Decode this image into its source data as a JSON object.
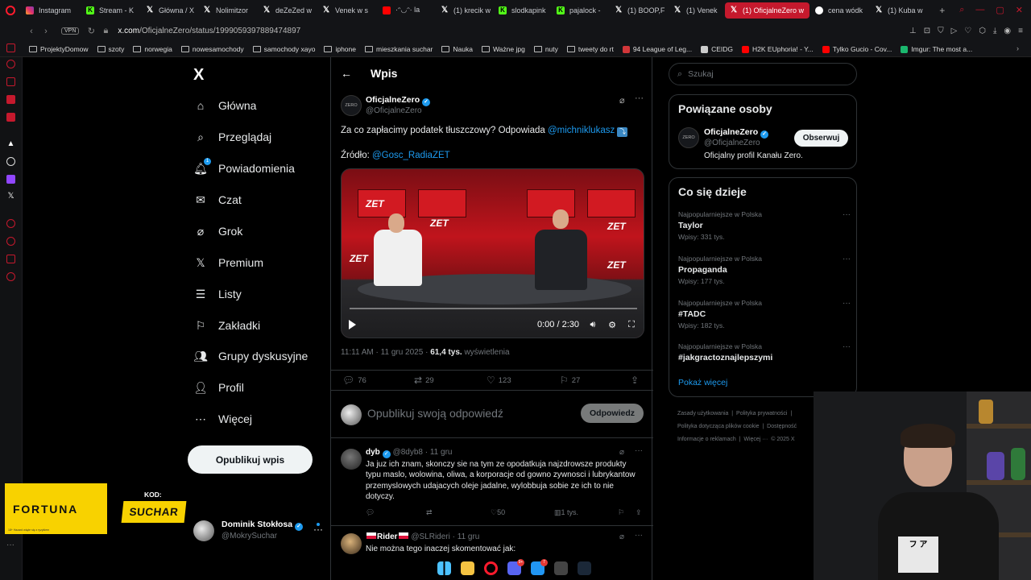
{
  "browser": {
    "tabs": [
      {
        "label": "Instagram",
        "icon": "instagram-icon",
        "active": false
      },
      {
        "label": "Stream - K",
        "icon": "kick-icon",
        "active": false
      },
      {
        "label": "Główna / X",
        "icon": "x-icon",
        "active": false
      },
      {
        "label": "Nolimitzor",
        "icon": "x-icon",
        "active": false
      },
      {
        "label": "deZeZed w",
        "icon": "x-icon",
        "active": false
      },
      {
        "label": "Venek w s",
        "icon": "x-icon",
        "active": false
      },
      {
        "label": "·ᵔ◡ᵔ· la",
        "icon": "youtube-icon",
        "active": false
      },
      {
        "label": "(1) krecik w",
        "icon": "x-icon",
        "active": false
      },
      {
        "label": "slodkapink",
        "icon": "kick-icon",
        "active": false
      },
      {
        "label": "pajalock -",
        "icon": "kick-icon",
        "active": false
      },
      {
        "label": "(1) BOOP,F",
        "icon": "x-icon",
        "active": false
      },
      {
        "label": "(1) Venek",
        "icon": "x-icon",
        "active": false
      },
      {
        "label": "(1) OficjalneZero w",
        "icon": "x-icon",
        "active": true
      },
      {
        "label": "cena wódk",
        "icon": "google-icon",
        "active": false
      },
      {
        "label": "(1) Kuba w",
        "icon": "x-icon",
        "active": false
      }
    ],
    "new_tab": "+",
    "vpn_label": "VPN",
    "url_domain": "x.com",
    "url_path": "/OficjalneZero/status/1999059397889474897",
    "bookmarks": [
      {
        "label": "ProjektyDomow",
        "type": "folder"
      },
      {
        "label": "szoty",
        "type": "folder"
      },
      {
        "label": "norwegia",
        "type": "folder"
      },
      {
        "label": "nowesamochody",
        "type": "folder"
      },
      {
        "label": "samochody xayo",
        "type": "folder"
      },
      {
        "label": "iphone",
        "type": "folder"
      },
      {
        "label": "mieszkania suchar",
        "type": "folder"
      },
      {
        "label": "Nauka",
        "type": "folder"
      },
      {
        "label": "Ważne jpg",
        "type": "folder"
      },
      {
        "label": "nuty",
        "type": "folder"
      },
      {
        "label": "tweety do rt",
        "type": "folder"
      },
      {
        "label": "94 League of Leg...",
        "type": "site",
        "color": "#d13639"
      },
      {
        "label": "CEIDG",
        "type": "site",
        "color": "#cccccc"
      },
      {
        "label": "H2K EUphoria! - Y...",
        "type": "site",
        "color": "#ff0000"
      },
      {
        "label": "Tylko Gucio - Cov...",
        "type": "site",
        "color": "#ff0000"
      },
      {
        "label": "Imgur: The most a...",
        "type": "site",
        "color": "#1bb76e"
      }
    ]
  },
  "nav": {
    "logo": "X",
    "items": [
      {
        "label": "Główna",
        "icon": "home-icon"
      },
      {
        "label": "Przeglądaj",
        "icon": "search-icon"
      },
      {
        "label": "Powiadomienia",
        "icon": "bell-icon",
        "badge": "1"
      },
      {
        "label": "Czat",
        "icon": "mail-icon"
      },
      {
        "label": "Grok",
        "icon": "grok-icon"
      },
      {
        "label": "Premium",
        "icon": "x-premium-icon"
      },
      {
        "label": "Listy",
        "icon": "list-icon"
      },
      {
        "label": "Zakładki",
        "icon": "bookmark-icon"
      },
      {
        "label": "Grupy dyskusyjne",
        "icon": "communities-icon"
      },
      {
        "label": "Profil",
        "icon": "profile-icon"
      },
      {
        "label": "Więcej",
        "icon": "more-circle-icon"
      }
    ],
    "post_button": "Opublikuj wpis",
    "account": {
      "name": "Dominik Stokłosa",
      "handle": "@MokrySuchar"
    }
  },
  "post": {
    "header_title": "Wpis",
    "author_name": "OficjalneZero",
    "author_handle": "@OficjalneZero",
    "avatar_text": "ZERO",
    "text_main": "Za co zapłacimy podatek tłuszczowy? Odpowiada",
    "text_mention": "@michniklukasz",
    "text_source_label": "Źródło:",
    "text_source_mention": "@Gosc_RadiaZET",
    "video_time": "0:00 / 2:30",
    "video_progress": 0.0,
    "video_brand": "ZET",
    "meta_time": "11:11 AM · 11 gru 2025 ·",
    "meta_views": "61,4 tys.",
    "meta_views_label": "wyświetlenia",
    "stats": {
      "replies": "76",
      "reposts": "29",
      "likes": "123",
      "bookmarks": "27"
    }
  },
  "reply_box": {
    "placeholder": "Opublikuj swoją odpowiedź",
    "button": "Odpowiedz"
  },
  "replies": [
    {
      "name": "dyb",
      "handle": "@8dyb8",
      "date": "· 11 gru",
      "verified": true,
      "text": "Ja juz ich znam, skonczy sie na tym ze opodatkuja najzdrowsze produkty typu maslo, wolowina, oliwa, a korporacje od gowno zywnosci i lubrykantow przemyslowych udajacych oleje jadalne, wylobbuja sobie ze ich to nie dotyczy.",
      "likes": "50",
      "views": "1 tys."
    },
    {
      "name": "Rider",
      "handle": "@SLRideri",
      "date": "· 11 gru",
      "verified": false,
      "text": "Nie można tego inaczej skomentować jak:"
    }
  ],
  "right": {
    "search_placeholder": "Szukaj",
    "related_title": "Powiązane osoby",
    "related": {
      "name": "OficjalneZero",
      "handle": "@OficjalneZero",
      "desc": "Oficjalny profil Kanału Zero.",
      "button": "Obserwuj"
    },
    "trends_title": "Co się dzieje",
    "trends": [
      {
        "category": "Najpopularniejsze w Polska",
        "title": "Taylor",
        "count": "Wpisy: 331 tys."
      },
      {
        "category": "Najpopularniejsze w Polska",
        "title": "Propaganda",
        "count": "Wpisy: 177 tys."
      },
      {
        "category": "Najpopularniejsze w Polska",
        "title": "#TADC",
        "count": "Wpisy: 182 tys."
      },
      {
        "category": "Najpopularniejsze w Polska",
        "title": "#jakgractoznajlepszymi",
        "count": ""
      }
    ],
    "show_more": "Pokaż więcej",
    "footer": {
      "line1a": "Zasady użytkowania",
      "line1b": "Polityka prywatności",
      "line2a": "Polityka dotycząca plików cookie",
      "line2b": "Dostępność",
      "line3a": "Informacje o reklamach",
      "line3b": "Więcej ···",
      "line3c": "© 2025 X"
    }
  },
  "overlay": {
    "sponsor": "FORTUNA",
    "sponsor_fine": "18+ Hazard wiąże się z ryzykiem",
    "code_label": "KOD:",
    "code_value": "SUCHAR",
    "shirt_print": "フ ア"
  },
  "taskbar": [
    {
      "icon": "windows-start-icon",
      "color": "#4cc2ff"
    },
    {
      "icon": "file-explorer-icon",
      "color": "#f5c342"
    },
    {
      "icon": "opera-icon",
      "color": "#ff1b2d"
    },
    {
      "icon": "discord-icon",
      "color": "#5865f2",
      "badge": "9+"
    },
    {
      "icon": "messenger-icon",
      "color": "#2196f3",
      "badge": "7"
    },
    {
      "icon": "obs-icon",
      "color": "#444444"
    },
    {
      "icon": "steam-icon",
      "color": "#1b2838"
    }
  ]
}
